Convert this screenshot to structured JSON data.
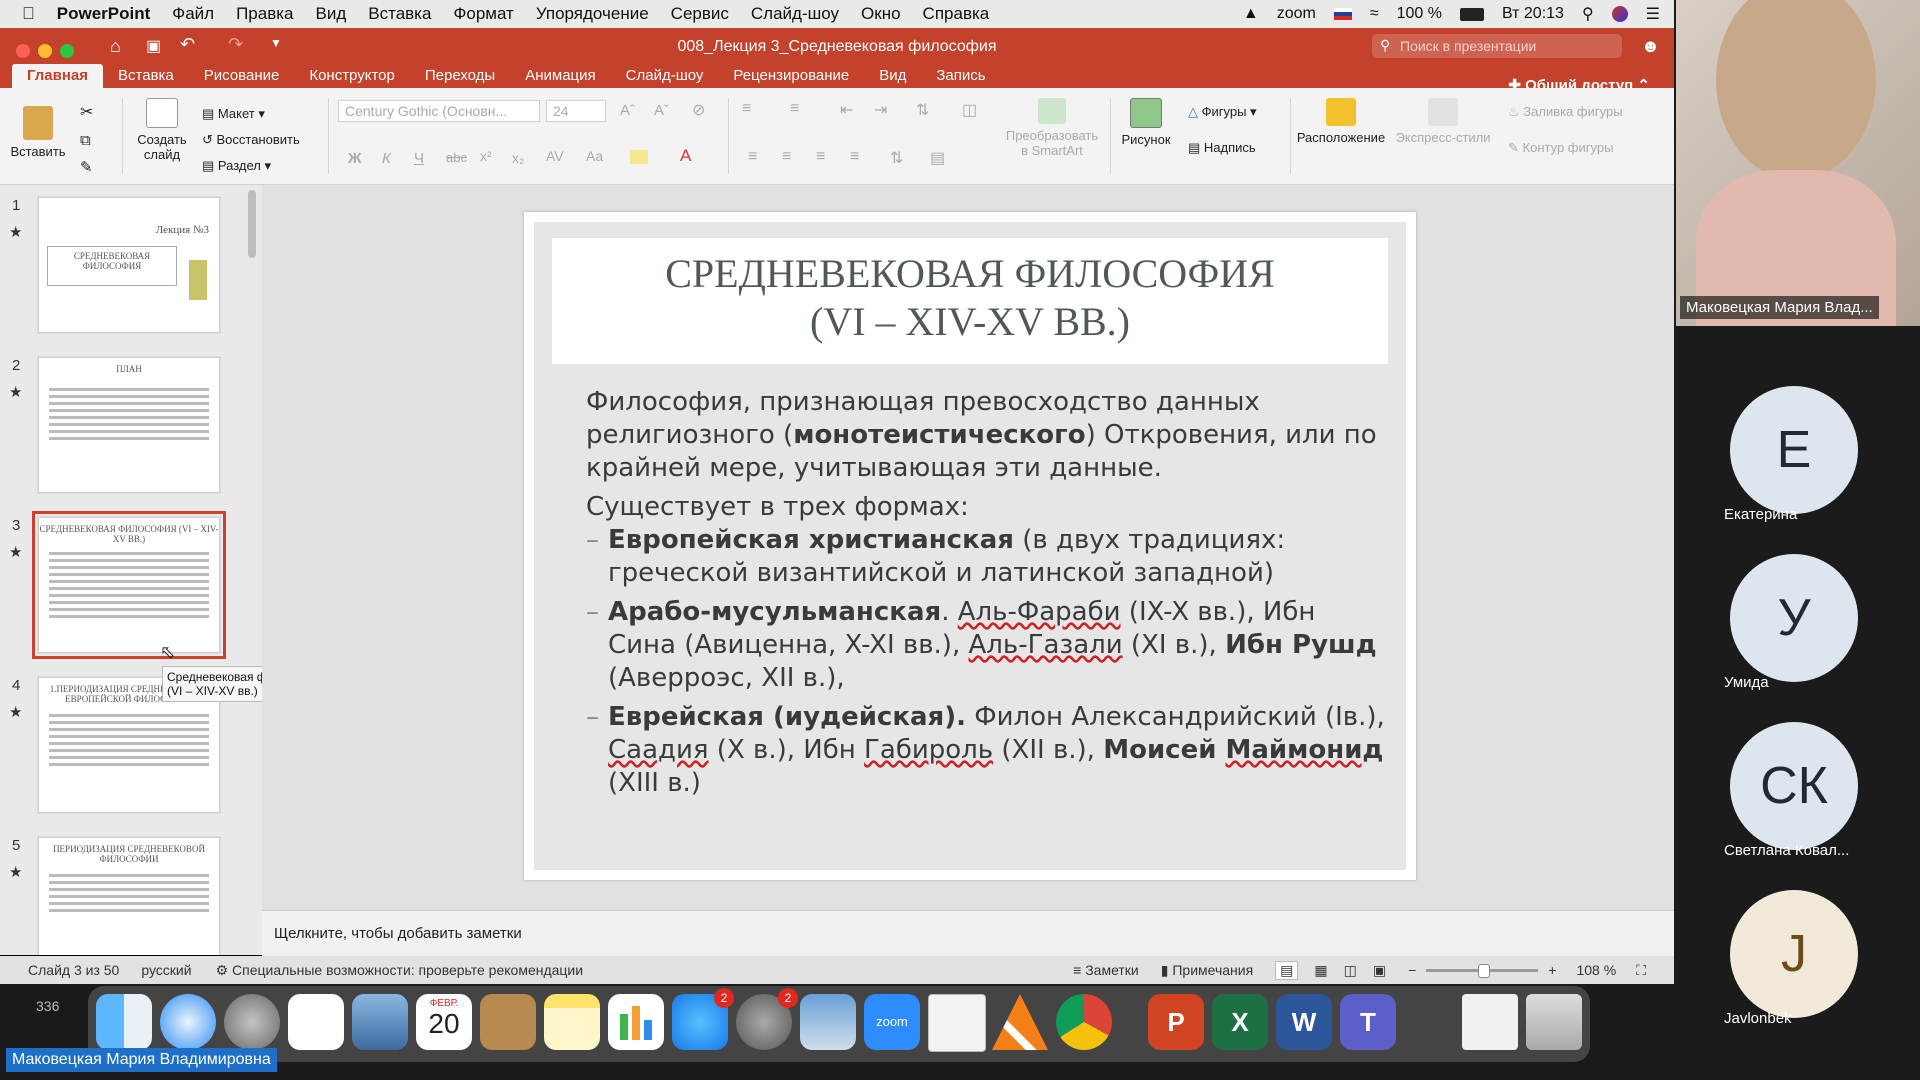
{
  "menubar": {
    "app": "PowerPoint",
    "items": [
      "Файл",
      "Правка",
      "Вид",
      "Вставка",
      "Формат",
      "Упорядочение",
      "Сервис",
      "Слайд-шоу",
      "Окно",
      "Справка"
    ],
    "battery": "100 %",
    "clock": "Вт 20:13",
    "zoom_label": "zoom"
  },
  "titlebar": {
    "title": "008_Лекция 3_Средневековая философия",
    "search_placeholder": "Поиск в презентации",
    "share": "Общий доступ"
  },
  "tabs": [
    "Главная",
    "Вставка",
    "Рисование",
    "Конструктор",
    "Переходы",
    "Анимация",
    "Слайд-шоу",
    "Рецензирование",
    "Вид",
    "Запись"
  ],
  "ribbon": {
    "paste": "Вставить",
    "new_slide_1": "Создать",
    "new_slide_2": "слайд",
    "layout": "Макет",
    "reset": "Восстановить",
    "section": "Раздел",
    "font_name": "Century Gothic (Основн...",
    "font_size": "24",
    "smartart_1": "Преобразовать",
    "smartart_2": "в SmartArt",
    "picture": "Рисунок",
    "shapes": "Фигуры",
    "textbox": "Надпись",
    "arrange": "Расположение",
    "quick_styles": "Экспресс-стили",
    "shape_fill": "Заливка фигуры",
    "shape_outline": "Контур фигуры",
    "bold": "Ж",
    "italic": "К",
    "underline": "Ч",
    "strike": "abc"
  },
  "thumbnails": [
    {
      "num": "1",
      "title": "Лекция №3",
      "sub": "СРЕДНЕВЕКОВАЯ ФИЛОСОФИЯ"
    },
    {
      "num": "2",
      "title": "ПЛАН"
    },
    {
      "num": "3",
      "title": "СРЕДНЕВЕКОВАЯ ФИЛОСОФИЯ (VI – XIV-XV ВВ.)"
    },
    {
      "num": "4",
      "title": "1.ПЕРИОДИЗАЦИЯ СРЕДНЕВЕКОВОЙ ЕВРОПЕЙСКОЙ ФИЛОСОФИИ"
    },
    {
      "num": "5",
      "title": "ПЕРИОДИЗАЦИЯ СРЕДНЕВЕКОВОЙ ФИЛОСОФИИ"
    }
  ],
  "tooltip": {
    "line1": "Средневековая философия",
    "line2": "(VI – XIV-XV вв.)"
  },
  "slide": {
    "title_1": "СРЕДНЕВЕКОВАЯ ФИЛОСОФИЯ",
    "title_2": "(VI – XIV-XV ВВ.)",
    "p1_a": "Философия, признающая превосходство данных религиозного (",
    "p1_b": "монотеистического",
    "p1_c": ") Откровения, или по крайней мере, учитывающая эти данные.",
    "p2": "Существует в трех формах:",
    "b1_a": "Европейская христианская",
    "b1_b": " (в двух традициях: греческой византийской и латинской западной)",
    "b2_a": "Арабо-мусульманская",
    "b2_b": ". ",
    "b2_c": "Аль-Фараби",
    "b2_d": " (IX-X вв.), Ибн Сина (Авиценна, X-XI вв.), ",
    "b2_e": "Аль-Газали",
    "b2_f": " (XI в.), ",
    "b2_g": "Ибн Рушд",
    "b2_h": " (Аверроэс, XII в.),",
    "b3_a": "Еврейская (иудейская).",
    "b3_b": " Филон Александрийский (Iв.), ",
    "b3_c": "Саадия",
    "b3_d": " (X в.), Ибн ",
    "b3_e": "Габироль",
    "b3_f": " (XII в.), ",
    "b3_g": "Моисей ",
    "b3_h": "Маймонид",
    "b3_i": " (XIII в.)"
  },
  "notes_placeholder": "Щелкните, чтобы добавить заметки",
  "status": {
    "slide_of": "Слайд 3 из 50",
    "language": "русский",
    "accessibility": "Специальные возможности: проверьте рекомендации",
    "notes": "Заметки",
    "comments": "Примечания",
    "zoom": "108 %",
    "small_num": "336"
  },
  "dock": {
    "calendar_month": "ФЕВР.",
    "calendar_day": "20",
    "appstore_badge": "2",
    "settings_badge": "2",
    "zoom_label": "zoom"
  },
  "presenter_tag": "Маковецкая Мария Владимировна",
  "zoom_panel": {
    "camera_name": "Маковецкая Мария Влад...",
    "participants": [
      {
        "initial": "Е",
        "name": "Екатерина",
        "color": "#dde6ee"
      },
      {
        "initial": "У",
        "name": "Умида",
        "color": "#dde6ee"
      },
      {
        "initial": "СК",
        "name": "Светлана Ковал...",
        "color": "#dde6ee"
      },
      {
        "initial": "J",
        "name": "Javlonbek",
        "color": "#f2ead9"
      }
    ]
  }
}
